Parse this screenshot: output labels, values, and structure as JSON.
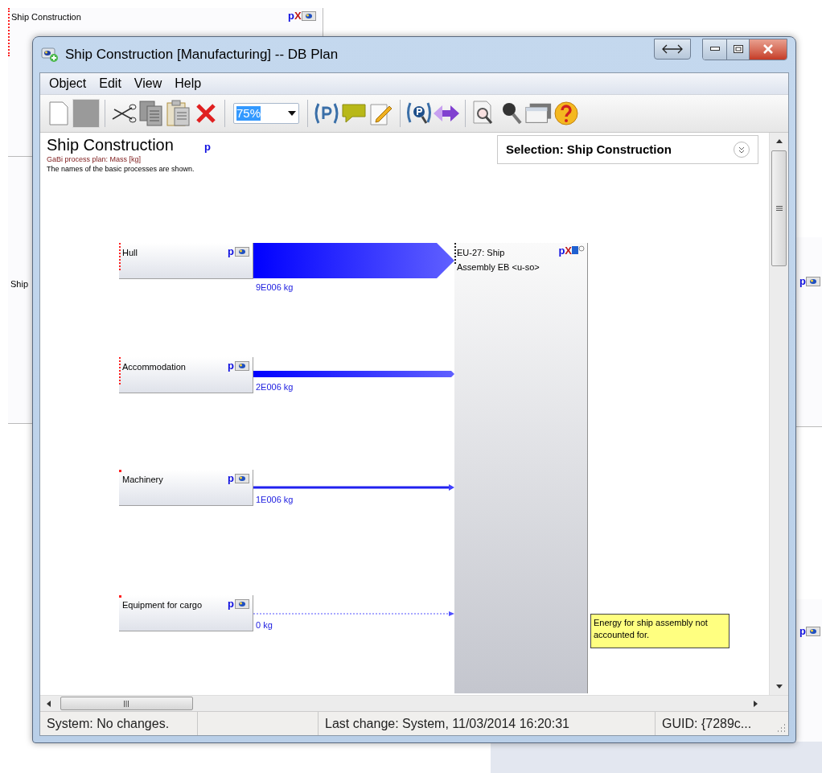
{
  "background": {
    "top_window": {
      "title": "Ship Construction",
      "badges": [
        "p",
        "X"
      ]
    },
    "left_window": {
      "title": "Ship"
    },
    "right_window": {
      "badges": [
        "p",
        "p"
      ]
    }
  },
  "window": {
    "title": "Ship Construction [Manufacturing] -- DB Plan"
  },
  "menu": [
    "Object",
    "Edit",
    "View",
    "Help"
  ],
  "toolbar": {
    "zoom": "75%"
  },
  "diagram": {
    "title": "Ship Construction",
    "title_badge": "p",
    "subtitle": "GaBi process plan: Mass [kg]",
    "info": "The names of the basic processes are shown.",
    "selection": "Selection: Ship Construction",
    "processes": [
      {
        "name": "Hull",
        "badge": "p",
        "kind": "line",
        "flow": {
          "kind": "wide",
          "label": "9E006 kg"
        }
      },
      {
        "name": "Accommodation",
        "badge": "p",
        "kind": "line",
        "flow": {
          "kind": "medium",
          "label": "2E006 kg"
        }
      },
      {
        "name": "Machinery",
        "badge": "p",
        "kind": "dot",
        "flow": {
          "kind": "thin",
          "label": "1E006 kg"
        }
      },
      {
        "name": "Equipment for cargo",
        "badge": "p",
        "kind": "dot",
        "flow": {
          "kind": "empty",
          "label": "0 kg"
        }
      }
    ],
    "target": {
      "name": "EU-27: Ship Assembly EB <u-so>",
      "badges": [
        "p",
        "X"
      ]
    },
    "comment": "Energy for ship assembly not accounted for."
  },
  "status_bar": [
    {
      "text": "System: No changes."
    },
    {
      "text": "Last change: System, 11/03/2014 16:20:31"
    },
    {
      "text": "GUID: {7289c..."
    }
  ]
}
